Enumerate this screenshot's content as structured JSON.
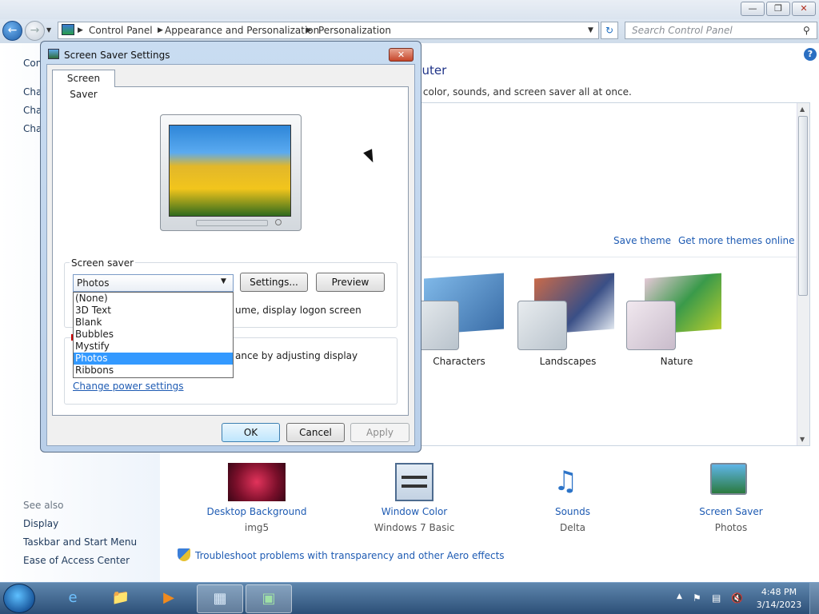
{
  "window": {
    "breadcrumb": [
      "Control Panel",
      "Appearance and Personalization",
      "Personalization"
    ],
    "search_placeholder": "Search Control Panel",
    "heading_partial": "puter",
    "subhead_partial": "v color, sounds, and screen saver all at once.",
    "left_partial": [
      "Con",
      "Cha",
      "Cha",
      "Cha"
    ],
    "see_also_label": "See also",
    "see_also": [
      "Display",
      "Taskbar and Start Menu",
      "Ease of Access Center"
    ],
    "save_theme": "Save theme",
    "get_more_themes": "Get more themes online",
    "themes": [
      "Characters",
      "Landscapes",
      "Nature"
    ],
    "bottom_items": [
      {
        "label": "Desktop Background",
        "sub": "img5",
        "icon": "flower-wallpaper-icon"
      },
      {
        "label": "Window Color",
        "sub": "Windows 7 Basic",
        "icon": "window-color-icon"
      },
      {
        "label": "Sounds",
        "sub": "Delta",
        "icon": "music-notes-icon"
      },
      {
        "label": "Screen Saver",
        "sub": "Photos",
        "icon": "screen-saver-icon"
      }
    ],
    "troubleshoot": "Troubleshoot problems with transparency and other Aero effects"
  },
  "dialog": {
    "title": "Screen Saver Settings",
    "tab": "Screen Saver",
    "group_label": "Screen saver",
    "combo_value": "Photos",
    "options": [
      "(None)",
      "3D Text",
      "Blank",
      "Bubbles",
      "Mystify",
      "Photos",
      "Ribbons"
    ],
    "selected_option": "Photos",
    "settings_btn": "Settings...",
    "preview_btn": "Preview",
    "resume_text": "ume, display logon screen",
    "power_text": "ance by adjusting display",
    "power_link": "Change power settings",
    "ok": "OK",
    "cancel": "Cancel",
    "apply": "Apply"
  },
  "taskbar": {
    "time": "4:48 PM",
    "date": "3/14/2023"
  }
}
